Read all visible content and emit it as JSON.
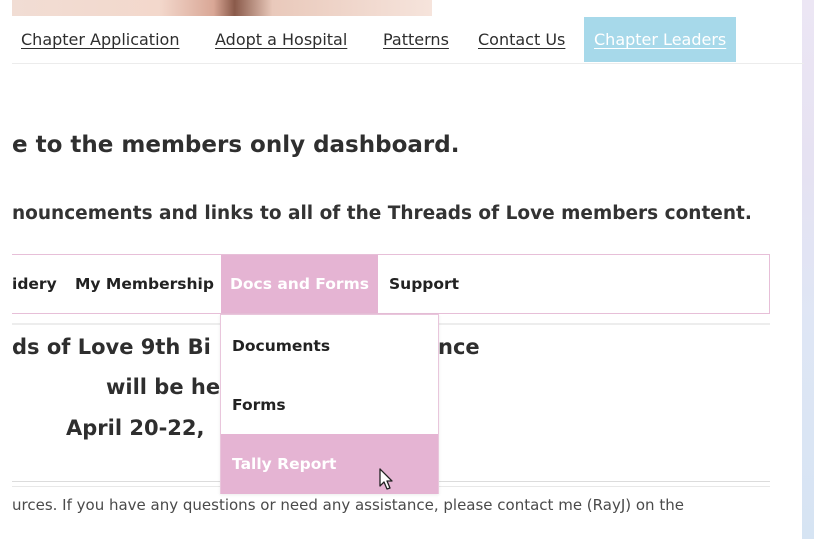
{
  "topnav": {
    "items": [
      {
        "label": "Chapter Application"
      },
      {
        "label": "Adopt a Hospital"
      },
      {
        "label": "Patterns"
      },
      {
        "label": "Contact Us"
      },
      {
        "label": "Chapter Leaders",
        "active": true
      }
    ],
    "active_bg": "#a7d9ea"
  },
  "dashboard": {
    "welcome": "e to the members only dashboard.",
    "intro": "nouncements and links to all of the Threads of Love members content."
  },
  "subnav": {
    "items": [
      {
        "label": "idery"
      },
      {
        "label": "My Membership"
      },
      {
        "label": "Docs and Forms",
        "active": true
      },
      {
        "label": "Support"
      }
    ],
    "accent": "#e5b4d3"
  },
  "dropdown": {
    "items": [
      {
        "label": "Documents"
      },
      {
        "label": "Forms"
      },
      {
        "label": "Tally Report",
        "hovered": true
      }
    ]
  },
  "announcement": {
    "line1": "ds of Love 9th Bi",
    "line1_tail": "nce",
    "line2": "will be he",
    "line3": "April 20-22,"
  },
  "body_text": "urces. If you have any questions or need any assistance, please contact me (RayJ) on the",
  "icons": {
    "cursor": "pointer-cursor-icon"
  }
}
